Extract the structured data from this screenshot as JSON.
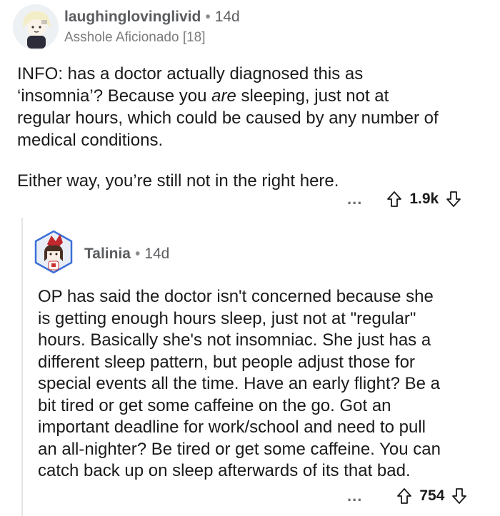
{
  "comments": [
    {
      "username": "laughinglovinglivid",
      "separator": "•",
      "time": "14d",
      "flair": "Asshole Aficionado [18]",
      "paragraphs": [
        [
          "INFO: has a doctor actually diagnosed this as",
          "‘insomnia’? Because you ",
          "are",
          " sleeping, just not at",
          "regular hours, which could be caused by any number of",
          "medical conditions."
        ],
        [
          "Either way, you’re still not in the right here."
        ]
      ],
      "more_label": "...",
      "score": "1.9k"
    },
    {
      "username": "Talinia",
      "separator": "•",
      "time": "14d",
      "lines": [
        "OP has said the doctor isn't concerned because she",
        "is getting enough hours sleep, just not at \"regular\"",
        "hours. Basically she's not insomniac. She just has a",
        "different sleep pattern, but people adjust those for",
        "special events all the time. Have an early flight? Be a",
        "bit tired or get some caffeine on the go. Got an",
        "important deadline for work/school and need to pull",
        "an all-nighter? Be tired or get some caffeine. You can",
        "catch back up on sleep afterwards of its that bad."
      ],
      "more_label": "...",
      "score": "754"
    }
  ]
}
